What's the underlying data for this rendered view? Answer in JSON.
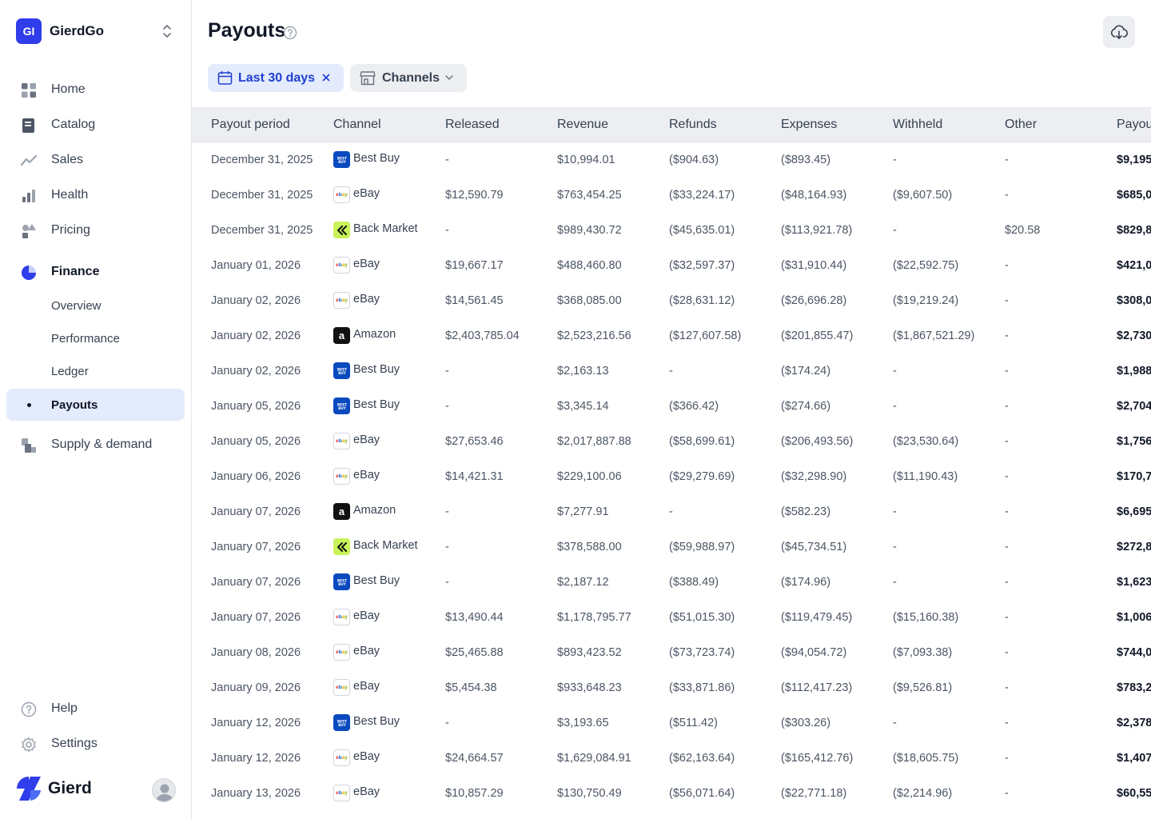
{
  "workspace": {
    "initials": "GI",
    "name": "GierdGo"
  },
  "nav": {
    "home": "Home",
    "catalog": "Catalog",
    "sales": "Sales",
    "health": "Health",
    "pricing": "Pricing",
    "finance": "Finance",
    "finance_sub": {
      "overview": "Overview",
      "performance": "Performance",
      "ledger": "Ledger",
      "payouts": "Payouts"
    },
    "supply": "Supply & demand",
    "help": "Help",
    "settings": "Settings"
  },
  "brand": {
    "name": "Gierd"
  },
  "page": {
    "title": "Payouts"
  },
  "filters": {
    "date_label": "Last 30 days",
    "channels_label": "Channels"
  },
  "table": {
    "headers": [
      "Payout period",
      "Channel",
      "Released",
      "Revenue",
      "Refunds",
      "Expenses",
      "Withheld",
      "Other",
      "Payout"
    ],
    "rows": [
      {
        "period": "December 31, 2025",
        "channel": "Best Buy",
        "logo": "bestbuy",
        "released": "-",
        "revenue": "$10,994.01",
        "refunds": "($904.63)",
        "expenses": "($893.45)",
        "withheld": "-",
        "other": "-",
        "payout": "$9,195"
      },
      {
        "period": "December 31, 2025",
        "channel": "eBay",
        "logo": "ebay",
        "released": "$12,590.79",
        "revenue": "$763,454.25",
        "refunds": "($33,224.17)",
        "expenses": "($48,164.93)",
        "withheld": "($9,607.50)",
        "other": "-",
        "payout": "$685,0"
      },
      {
        "period": "December 31, 2025",
        "channel": "Back Market",
        "logo": "backmarket",
        "released": "-",
        "revenue": "$989,430.72",
        "refunds": "($45,635.01)",
        "expenses": "($113,921.78)",
        "withheld": "-",
        "other": "$20.58",
        "payout": "$829,8"
      },
      {
        "period": "January 01, 2026",
        "channel": "eBay",
        "logo": "ebay",
        "released": "$19,667.17",
        "revenue": "$488,460.80",
        "refunds": "($32,597.37)",
        "expenses": "($31,910.44)",
        "withheld": "($22,592.75)",
        "other": "-",
        "payout": "$421,0"
      },
      {
        "period": "January 02, 2026",
        "channel": "eBay",
        "logo": "ebay",
        "released": "$14,561.45",
        "revenue": "$368,085.00",
        "refunds": "($28,631.12)",
        "expenses": "($26,696.28)",
        "withheld": "($19,219.24)",
        "other": "-",
        "payout": "$308,0"
      },
      {
        "period": "January 02, 2026",
        "channel": "Amazon",
        "logo": "amazon",
        "released": "$2,403,785.04",
        "revenue": "$2,523,216.56",
        "refunds": "($127,607.58)",
        "expenses": "($201,855.47)",
        "withheld": "($1,867,521.29)",
        "other": "-",
        "payout": "$2,730"
      },
      {
        "period": "January 02, 2026",
        "channel": "Best Buy",
        "logo": "bestbuy",
        "released": "-",
        "revenue": "$2,163.13",
        "refunds": "-",
        "expenses": "($174.24)",
        "withheld": "-",
        "other": "-",
        "payout": "$1,988"
      },
      {
        "period": "January 05, 2026",
        "channel": "Best Buy",
        "logo": "bestbuy",
        "released": "-",
        "revenue": "$3,345.14",
        "refunds": "($366.42)",
        "expenses": "($274.66)",
        "withheld": "-",
        "other": "-",
        "payout": "$2,704"
      },
      {
        "period": "January 05, 2026",
        "channel": "eBay",
        "logo": "ebay",
        "released": "$27,653.46",
        "revenue": "$2,017,887.88",
        "refunds": "($58,699.61)",
        "expenses": "($206,493.56)",
        "withheld": "($23,530.64)",
        "other": "-",
        "payout": "$1,756"
      },
      {
        "period": "January 06, 2026",
        "channel": "eBay",
        "logo": "ebay",
        "released": "$14,421.31",
        "revenue": "$229,100.06",
        "refunds": "($29,279.69)",
        "expenses": "($32,298.90)",
        "withheld": "($11,190.43)",
        "other": "-",
        "payout": "$170,7"
      },
      {
        "period": "January 07, 2026",
        "channel": "Amazon",
        "logo": "amazon",
        "released": "-",
        "revenue": "$7,277.91",
        "refunds": "-",
        "expenses": "($582.23)",
        "withheld": "-",
        "other": "-",
        "payout": "$6,695"
      },
      {
        "period": "January 07, 2026",
        "channel": "Back Market",
        "logo": "backmarket",
        "released": "-",
        "revenue": "$378,588.00",
        "refunds": "($59,988.97)",
        "expenses": "($45,734.51)",
        "withheld": "-",
        "other": "-",
        "payout": "$272,8"
      },
      {
        "period": "January 07, 2026",
        "channel": "Best Buy",
        "logo": "bestbuy",
        "released": "-",
        "revenue": "$2,187.12",
        "refunds": "($388.49)",
        "expenses": "($174.96)",
        "withheld": "-",
        "other": "-",
        "payout": "$1,623"
      },
      {
        "period": "January 07, 2026",
        "channel": "eBay",
        "logo": "ebay",
        "released": "$13,490.44",
        "revenue": "$1,178,795.77",
        "refunds": "($51,015.30)",
        "expenses": "($119,479.45)",
        "withheld": "($15,160.38)",
        "other": "-",
        "payout": "$1,006"
      },
      {
        "period": "January 08, 2026",
        "channel": "eBay",
        "logo": "ebay",
        "released": "$25,465.88",
        "revenue": "$893,423.52",
        "refunds": "($73,723.74)",
        "expenses": "($94,054.72)",
        "withheld": "($7,093.38)",
        "other": "-",
        "payout": "$744,0"
      },
      {
        "period": "January 09, 2026",
        "channel": "eBay",
        "logo": "ebay",
        "released": "$5,454.38",
        "revenue": "$933,648.23",
        "refunds": "($33,871.86)",
        "expenses": "($112,417.23)",
        "withheld": "($9,526.81)",
        "other": "-",
        "payout": "$783,2"
      },
      {
        "period": "January 12, 2026",
        "channel": "Best Buy",
        "logo": "bestbuy",
        "released": "-",
        "revenue": "$3,193.65",
        "refunds": "($511.42)",
        "expenses": "($303.26)",
        "withheld": "-",
        "other": "-",
        "payout": "$2,378"
      },
      {
        "period": "January 12, 2026",
        "channel": "eBay",
        "logo": "ebay",
        "released": "$24,664.57",
        "revenue": "$1,629,084.91",
        "refunds": "($62,163.64)",
        "expenses": "($165,412.76)",
        "withheld": "($18,605.75)",
        "other": "-",
        "payout": "$1,407"
      },
      {
        "period": "January 13, 2026",
        "channel": "eBay",
        "logo": "ebay",
        "released": "$10,857.29",
        "revenue": "$130,750.49",
        "refunds": "($56,071.64)",
        "expenses": "($22,771.18)",
        "withheld": "($2,214.96)",
        "other": "-",
        "payout": "$60,55"
      }
    ]
  },
  "colors": {
    "accent": "#2f3dea",
    "active_bg": "#e3ebfc",
    "header_bg": "#eceef1",
    "bestbuy": "#0a4abf",
    "backmarket": "#c9f25a"
  },
  "icons": [
    "chevron-updown-icon",
    "grid-icon",
    "book-icon",
    "trend-icon",
    "bar-chart-icon",
    "shapes-icon",
    "pie-icon",
    "boxes-icon",
    "help-circle-icon",
    "gear-icon",
    "cloud-download-icon",
    "calendar-icon",
    "close-icon",
    "store-icon",
    "chevron-down-icon"
  ]
}
